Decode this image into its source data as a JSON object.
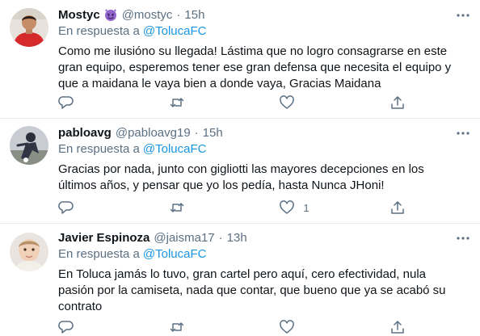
{
  "tweets": [
    {
      "name": "Mostyc",
      "emoji_icon": "smiling-devil-emoji-icon",
      "handle": "@mostyc",
      "dot": "·",
      "time": "15h",
      "reply_prefix": "En respuesta a",
      "reply_to": "@TolucaFC",
      "text": "Como me ilusióno su llegada! Lástima que no logro consagrarse en este gran equipo, esperemos tener ese gran defensa que necesita el equipo y que a maidana le vaya bien a donde vaya, Gracias Maidana",
      "like_count": ""
    },
    {
      "name": "pabloavg",
      "handle": "@pabloavg19",
      "dot": "·",
      "time": "15h",
      "reply_prefix": "En respuesta a",
      "reply_to": "@TolucaFC",
      "text": "Gracias por nada, junto con gigliotti las mayores decepciones en los últimos años, y pensar que yo los pedía, hasta Nunca JHoni!",
      "like_count": "1"
    },
    {
      "name": "Javier Espinoza",
      "handle": "@jaisma17",
      "dot": "·",
      "time": "13h",
      "reply_prefix": "En respuesta a",
      "reply_to": "@TolucaFC",
      "text": "En Toluca jamás lo tuvo, gran cartel pero aquí, cero efectividad, nula pasión por la camiseta, nada que contar, que bueno que ya se acabó su contrato",
      "like_count": ""
    }
  ],
  "colors": {
    "text": "#0f1419",
    "secondary": "#5b7083",
    "link": "#1b95e0",
    "divider": "#e6ecf0",
    "emoji": "#9266cc"
  }
}
